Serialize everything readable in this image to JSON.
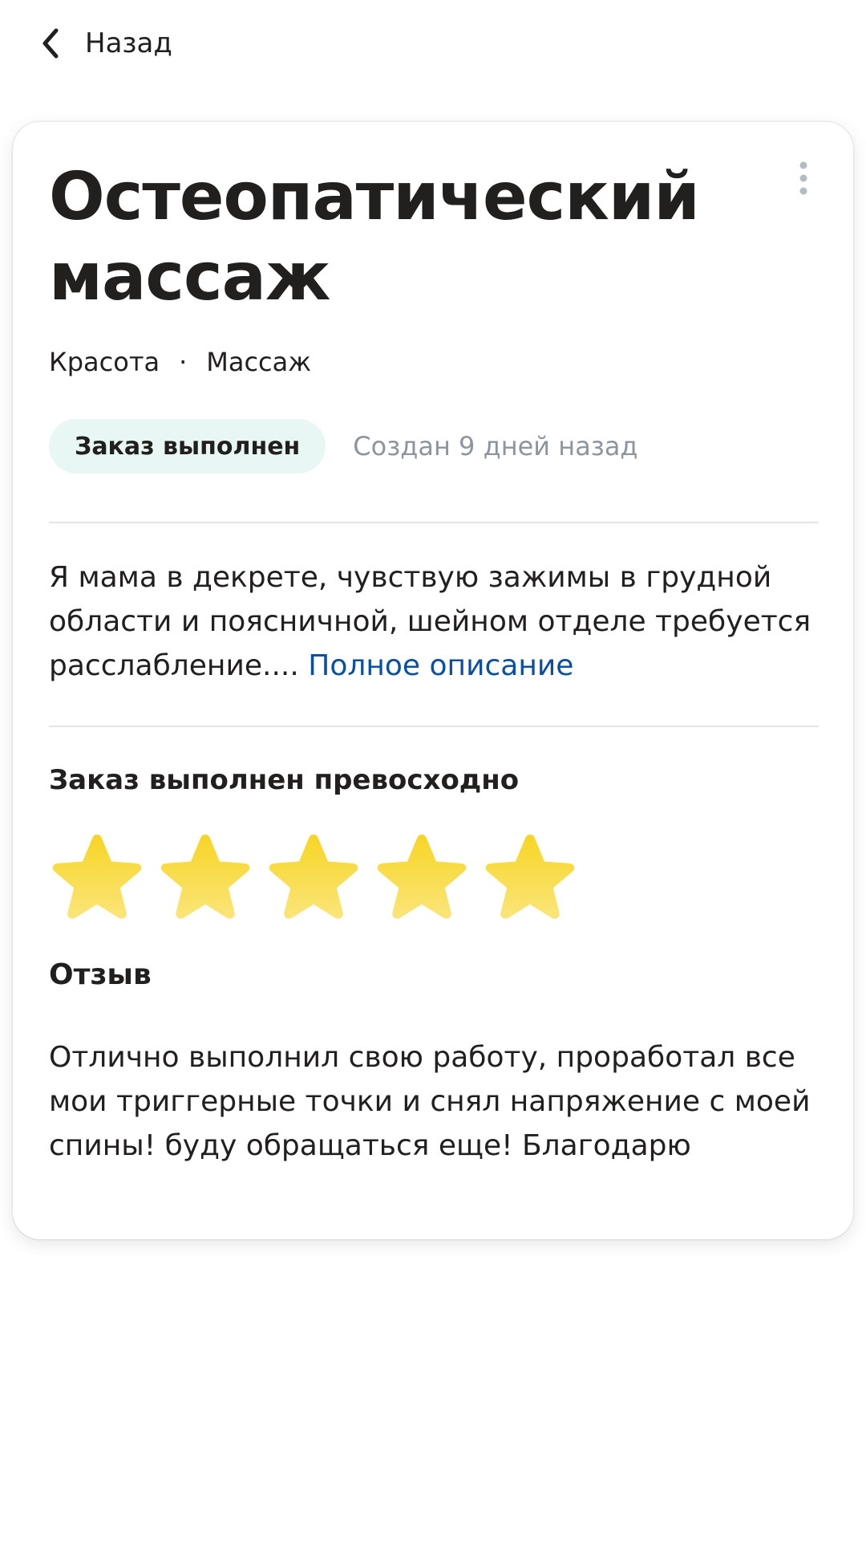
{
  "topbar": {
    "back_label": "Назад",
    "back_icon": "chevron-left-icon"
  },
  "order": {
    "title": "Остеопатический массаж",
    "categories": [
      "Красота",
      "Массаж"
    ],
    "category_separator": "·",
    "status_badge": "Заказ выполнен",
    "created": "Создан 9 дней назад",
    "description": "Я мама в декрете, чувствую зажимы в грудной области и поясничной, шейном отделе требуется расслабление....",
    "description_link": "Полное описание",
    "more_icon": "more-vertical-icon"
  },
  "rating": {
    "title": "Заказ выполнен превосходно",
    "stars": 5,
    "max_stars": 5,
    "star_color": "#f7d524"
  },
  "review": {
    "title": "Отзыв",
    "text": "Отлично выполнил свою работу, проработал все мои триггерные точки и снял напряжение с моей спины! буду обращаться еще! Благодарю"
  },
  "colors": {
    "badge_bg": "#e8f6f4",
    "link": "#0a4fa3",
    "muted_text": "#8d969c"
  }
}
